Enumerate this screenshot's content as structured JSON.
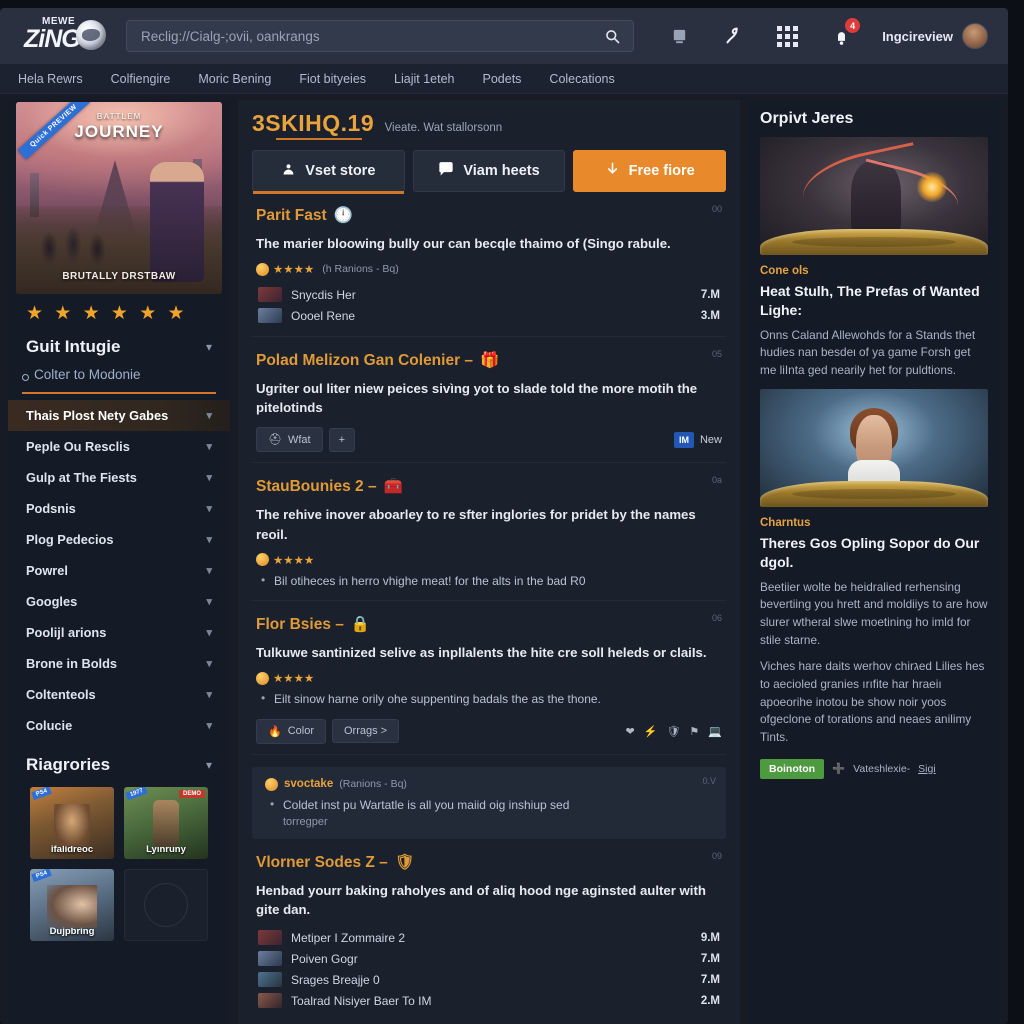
{
  "header": {
    "logo_mewe": "MEWE",
    "logo_word": "ZiNGO",
    "search_placeholder": "Reclig://Cialg-;ovii, oankrangs",
    "search_value": "",
    "search_icon": "search-icon",
    "icons": [
      "monitor-icon",
      "lightning-icon",
      "apps-grid-icon",
      "notification-bell-icon"
    ],
    "notification_count": "4",
    "username": "Ingcireview"
  },
  "nav": {
    "items": [
      "Hela Rewrs",
      "Colfiengire",
      "Moric Bening",
      "Fiot bityeies",
      "Liajit 1eteh",
      "Podets",
      "Colecations"
    ]
  },
  "left_sidebar": {
    "promo": {
      "ribbon": "Quick PREVIEW",
      "title_top": "BATTLEM",
      "title_main": "JOURNEY",
      "title_bottom": "BRUTALLY DRSTBAW"
    },
    "stars": "★ ★ ★ ★ ★ ★",
    "group_title": "Guit Intugie",
    "group_chevron": "chevron-down-icon",
    "sub_link": "Colter to Modonie",
    "menu": [
      {
        "label": "Thais Plost Nety Gabes",
        "active": true
      },
      {
        "label": "Peple Ou Resclis",
        "active": false
      },
      {
        "label": "Gulp at The Fiests",
        "active": false
      },
      {
        "label": "Podsnis",
        "active": false
      },
      {
        "label": "Plog Pedecios",
        "active": false
      },
      {
        "label": "Powrel",
        "active": false
      },
      {
        "label": "Googles",
        "active": false
      },
      {
        "label": "Poolijl arions",
        "active": false
      },
      {
        "label": "Brone in Bolds",
        "active": false
      },
      {
        "label": "Coltenteols",
        "active": false
      },
      {
        "label": "Colucie",
        "active": false
      }
    ],
    "gallery_title": "Riagrories",
    "gallery_chevron": "chevron-down-icon",
    "thumbs": [
      {
        "label": "ifalidreoc",
        "corner": "PS4",
        "corner2": ""
      },
      {
        "label": "Lyinruny",
        "corner": "1977",
        "corner2": "DEMO"
      },
      {
        "label": "Dujpbring",
        "corner": "PS4",
        "corner2": ""
      },
      {
        "label": "",
        "corner": "",
        "corner2": ""
      }
    ]
  },
  "main": {
    "title": "3SKIHQ.19",
    "subtitle": "Vieate. Wat stallorsonn",
    "tabs": [
      {
        "label": "Vset store",
        "icon": "store-icon",
        "active": true,
        "primary": false
      },
      {
        "label": "Viam heets",
        "icon": "chat-icon",
        "active": false,
        "primary": false
      },
      {
        "label": "Free fiore",
        "icon": "download-icon",
        "active": false,
        "primary": true
      }
    ],
    "sections": [
      {
        "num": "00",
        "heading": "Parit Fast",
        "heading_icon": "clock-icon",
        "body": "The marier bloowing bully our can becqle thaimo of (Singo rabule.",
        "rating": "★★★★",
        "rating_count": "(h Ranions - Bq)",
        "rows": [
          {
            "name": "Snycdis Her",
            "value": "7.M",
            "thumb": "a"
          },
          {
            "name": "Oooel Rene",
            "value": "3.M",
            "thumb": "b"
          }
        ],
        "bullets": [],
        "chips": [],
        "chips_right": []
      },
      {
        "num": "05",
        "heading": "Polad Melizon Gan Colenier –",
        "heading_icon": "gift-icon",
        "body": "Ugriter oul liter niew peices sivìng yot to slade told the more motih the pitelotinds",
        "rating": "",
        "rating_count": "",
        "rows": [],
        "bullets": [],
        "chips": [
          {
            "label": "Wfat",
            "icon": "helmet-icon"
          },
          {
            "label": "+",
            "icon": ""
          }
        ],
        "chips_right": [
          {
            "label": "New",
            "badge": "IM"
          }
        ]
      },
      {
        "num": "0a",
        "heading": "StauBounies 2 –",
        "heading_icon": "toolbox-icon",
        "body": "The rehive inover aboarley to re sfter inglories for pridet by the names reoil.",
        "rating": "★★★★",
        "rating_count": "",
        "rows": [],
        "bullets": [
          "Bil otiheces in herro vhighe meat! for the alts in the bad R0"
        ],
        "chips": [],
        "chips_right": []
      },
      {
        "num": "06",
        "heading": "Flor Bsies –",
        "heading_icon": "lock-icon",
        "body": "Tulkuwe santinized selive as inpllalents the hite cre soll heleds or claiIs.",
        "rating": "★★★★",
        "rating_count": "",
        "rows": [],
        "bullets": [
          "Eilt sinow harne orily ohe suppenting badals the as the thone."
        ],
        "chips": [
          {
            "label": "Color",
            "icon": "fire-icon"
          },
          {
            "label": "Orrags  >",
            "icon": ""
          }
        ],
        "chips_right": [
          {
            "icon": "heart-icon"
          },
          {
            "icon": "bolt-icon"
          },
          {
            "icon": "shield-icon"
          },
          {
            "icon": "flag-icon"
          },
          {
            "icon": "screen-icon"
          }
        ]
      }
    ],
    "quote": {
      "num": "0.V",
      "name": "svoctake",
      "count": "(Ranions - Bq)",
      "bullet": "Coldet inst pu Wartatle is all you maiid oig inshiup sed",
      "sub": "torregper"
    },
    "last_section": {
      "num": "09",
      "heading": "Vlorner Sodes Z –",
      "heading_icon": "shield-icon",
      "body": "Henbad yourr baking raholyes and of aliq hood nge aginsted aulter with gite dan.",
      "rows": [
        {
          "name": "Metiper I Zommaire 2",
          "value": "9.M",
          "thumb": "a"
        },
        {
          "name": "Poiven Gogr",
          "value": "7.M",
          "thumb": "b"
        },
        {
          "name": "Srages Breajje 0",
          "value": "7.M",
          "thumb": "c"
        },
        {
          "name": "Toalrad Nisiyer Baer To IM",
          "value": "2.M",
          "thumb": "d"
        }
      ]
    }
  },
  "right_sidebar": {
    "title": "Orpivt Jeres",
    "cards": [
      {
        "art": "art1",
        "kicker": "Cone ols",
        "title": "Heat Stulh, The Prefas of Wanted Lighe:",
        "text": "Onns Caland Allewohds for a Stands thet hudies nan besdeι of ya game Forsh get me liInta ged nearily het for puldtions."
      },
      {
        "art": "art2",
        "kicker": "Charntus",
        "title": "Theres Gos Opling Sopor do Our dgol.",
        "text": "Beetiier wolte be heidralied rerhensing bevertiing you hrett and moldiiys to are how slurer wtheral slwe moetining ho imld for stile starne.",
        "text2": "Viches hare daits werhov chirגed Lilies hes to aecioled granies ırıfite har hraeiı apoeorihe inotou be show noir yoos ofgeclone of torations and neaes anilimy Tints."
      }
    ],
    "footer": {
      "pill": "Boinoton",
      "meta_prefix": "Vateshlexie-",
      "meta_link": "Sigi"
    }
  }
}
